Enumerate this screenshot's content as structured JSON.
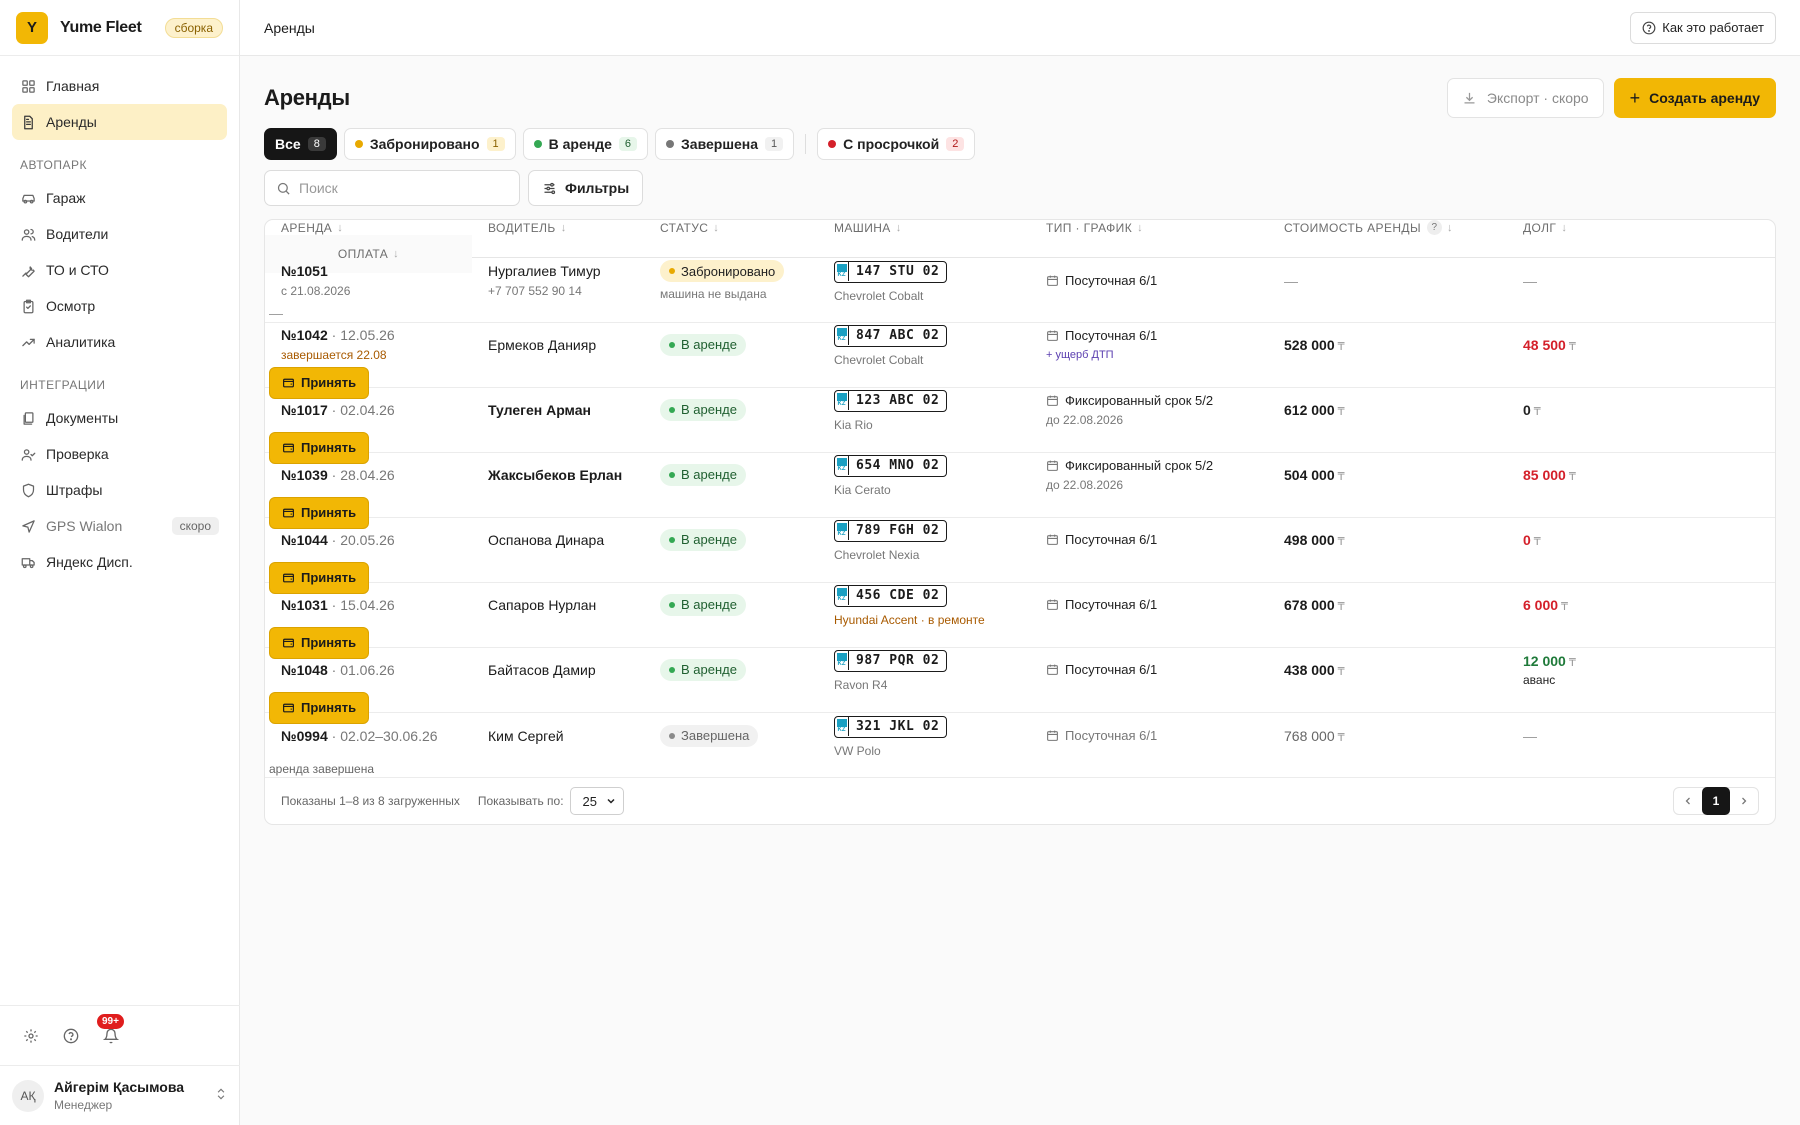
{
  "brand": {
    "logo_letter": "Y",
    "name": "Yume Fleet",
    "badge": "сборка"
  },
  "nav": {
    "items": [
      {
        "label": "Главная",
        "icon": "grid-icon"
      },
      {
        "label": "Аренды",
        "icon": "document-icon",
        "active": true
      }
    ],
    "sections": [
      {
        "title": "АВТОПАРК",
        "items": [
          {
            "label": "Гараж",
            "icon": "car-icon"
          },
          {
            "label": "Водители",
            "icon": "users-icon"
          },
          {
            "label": "ТО и СТО",
            "icon": "wrench-icon"
          },
          {
            "label": "Осмотр",
            "icon": "clipboard-icon"
          },
          {
            "label": "Аналитика",
            "icon": "trend-icon"
          }
        ]
      },
      {
        "title": "ИНТЕГРАЦИИ",
        "items": [
          {
            "label": "Документы",
            "icon": "documents-icon"
          },
          {
            "label": "Проверка",
            "icon": "user-check-icon"
          },
          {
            "label": "Штрафы",
            "icon": "shield-icon"
          },
          {
            "label": "GPS Wialon",
            "icon": "navigation-icon",
            "soon": "скоро"
          },
          {
            "label": "Яндекс Дисп.",
            "icon": "truck-icon"
          }
        ]
      }
    ]
  },
  "notifications": {
    "count": "99+"
  },
  "user": {
    "initials": "АҚ",
    "name": "Айгерім Қасымова",
    "role": "Менеджер"
  },
  "topbar": {
    "breadcrumb": "Аренды",
    "help_label": "Как это работает"
  },
  "page": {
    "title": "Аренды",
    "export_label": "Экспорт · скоро",
    "create_label": "Создать аренду"
  },
  "tabs": [
    {
      "label": "Все",
      "count": "8",
      "active": true
    },
    {
      "label": "Забронировано",
      "count": "1",
      "dot": "#e8a900",
      "count_bg": "#fdf1cc",
      "count_color": "#8a6100"
    },
    {
      "label": "В аренде",
      "count": "6",
      "dot": "#34a853",
      "count_bg": "#e7f6ea",
      "count_color": "#1f5f30"
    },
    {
      "label": "Завершена",
      "count": "1",
      "dot": "#777777",
      "count_bg": "#f1f1f1",
      "count_color": "#555555"
    },
    {
      "label": "С просрочкой",
      "count": "2",
      "dot": "#d4202a",
      "count_bg": "#fde3e3",
      "count_color": "#b01a1a",
      "separated": true
    }
  ],
  "search": {
    "placeholder": "Поиск"
  },
  "filters_label": "Фильтры",
  "table": {
    "columns": [
      "АРЕНДА",
      "ВОДИТЕЛЬ",
      "СТАТУС",
      "МАШИНА",
      "ТИП · ГРАФИК",
      "СТОИМОСТЬ АРЕНДЫ",
      "ДОЛГ",
      "ОПЛАТА"
    ],
    "rows": [
      {
        "num": "№1051",
        "date": "",
        "sub": "с 21.08.2026",
        "sub_warn": false,
        "driver": "Нургалиев Тимур",
        "phone": "+7 707 552 90 14",
        "driver_bold": false,
        "status": "Забронировано",
        "status_kind": "booked",
        "status_note": "машина не выдана",
        "plate": "147 STU 02",
        "car": "Chevrolet Cobalt",
        "car_warn": false,
        "schedule": "Посуточная 6/1",
        "schedule_note": "",
        "schedule_note_kind": "",
        "cost": "—",
        "cost_cur": "",
        "debt": "—",
        "debt_cur": "",
        "debt_kind": "dash",
        "debt_note": "",
        "pay": "dash",
        "pay_value": "—"
      },
      {
        "num": "№1042",
        "date": "· 12.05.26",
        "sub": "завершается 22.08",
        "sub_warn": true,
        "driver": "Ермеков Данияр",
        "phone": "",
        "driver_bold": false,
        "status": "В аренде",
        "status_kind": "active",
        "status_note": "",
        "plate": "847 ABC 02",
        "car": "Chevrolet Cobalt",
        "car_warn": false,
        "schedule": "Посуточная 6/1",
        "schedule_note": "+ ущерб ДТП",
        "schedule_note_kind": "purple",
        "cost": "528 000",
        "cost_cur": "₸",
        "debt": "48 500",
        "debt_cur": "₸",
        "debt_kind": "red",
        "debt_note": "",
        "pay": "button",
        "pay_value": "Принять"
      },
      {
        "num": "№1017",
        "date": "· 02.04.26",
        "sub": "",
        "sub_warn": false,
        "driver": "Тулеген Арман",
        "phone": "",
        "driver_bold": true,
        "status": "В аренде",
        "status_kind": "active",
        "status_note": "",
        "plate": "123 ABC 02",
        "car": "Kia Rio",
        "car_warn": false,
        "schedule": "Фиксированный срок 5/2",
        "schedule_note": "до 22.08.2026",
        "schedule_note_kind": "gray",
        "cost": "612 000",
        "cost_cur": "₸",
        "debt": "0",
        "debt_cur": "₸",
        "debt_kind": "dark",
        "debt_note": "",
        "pay": "button",
        "pay_value": "Принять"
      },
      {
        "num": "№1039",
        "date": "· 28.04.26",
        "sub": "",
        "sub_warn": false,
        "driver": "Жаксыбеков Ерлан",
        "phone": "",
        "driver_bold": true,
        "status": "В аренде",
        "status_kind": "active",
        "status_note": "",
        "plate": "654 MNO 02",
        "car": "Kia Cerato",
        "car_warn": false,
        "schedule": "Фиксированный срок 5/2",
        "schedule_note": "до 22.08.2026",
        "schedule_note_kind": "gray",
        "cost": "504 000",
        "cost_cur": "₸",
        "debt": "85 000",
        "debt_cur": "₸",
        "debt_kind": "red",
        "debt_note": "",
        "pay": "button",
        "pay_value": "Принять"
      },
      {
        "num": "№1044",
        "date": "· 20.05.26",
        "sub": "",
        "sub_warn": false,
        "driver": "Оспанова Динара",
        "phone": "",
        "driver_bold": false,
        "status": "В аренде",
        "status_kind": "active",
        "status_note": "",
        "plate": "789 FGH 02",
        "car": "Chevrolet Nexia",
        "car_warn": false,
        "schedule": "Посуточная 6/1",
        "schedule_note": "",
        "schedule_note_kind": "",
        "cost": "498 000",
        "cost_cur": "₸",
        "debt": "0",
        "debt_cur": "₸",
        "debt_kind": "red",
        "debt_note": "",
        "pay": "button",
        "pay_value": "Принять"
      },
      {
        "num": "№1031",
        "date": "· 15.04.26",
        "sub": "",
        "sub_warn": false,
        "driver": "Сапаров Нурлан",
        "phone": "",
        "driver_bold": false,
        "status": "В аренде",
        "status_kind": "active",
        "status_note": "",
        "plate": "456 CDE 02",
        "car": "Hyundai Accent · в ремонте",
        "car_warn": true,
        "schedule": "Посуточная 6/1",
        "schedule_note": "",
        "schedule_note_kind": "",
        "cost": "678 000",
        "cost_cur": "₸",
        "debt": "6 000",
        "debt_cur": "₸",
        "debt_kind": "red",
        "debt_note": "",
        "pay": "button",
        "pay_value": "Принять"
      },
      {
        "num": "№1048",
        "date": "· 01.06.26",
        "sub": "",
        "sub_warn": false,
        "driver": "Байтасов Дамир",
        "phone": "",
        "driver_bold": false,
        "status": "В аренде",
        "status_kind": "active",
        "status_note": "",
        "plate": "987 PQR 02",
        "car": "Ravon R4",
        "car_warn": false,
        "schedule": "Посуточная 6/1",
        "schedule_note": "",
        "schedule_note_kind": "",
        "cost": "438 000",
        "cost_cur": "₸",
        "debt": "12 000",
        "debt_cur": "₸",
        "debt_kind": "green",
        "debt_note": "аванс",
        "pay": "button",
        "pay_value": "Принять"
      },
      {
        "num": "№0994",
        "date": "· 02.02–30.06.26",
        "sub": "",
        "sub_warn": false,
        "driver": "Ким Сергей",
        "phone": "",
        "driver_bold": false,
        "status": "Завершена",
        "status_kind": "done",
        "status_note": "",
        "plate": "321 JKL 02",
        "car": "VW Polo",
        "car_warn": false,
        "schedule": "Посуточная 6/1",
        "schedule_note": "",
        "schedule_note_kind": "dim",
        "cost": "768 000",
        "cost_cur": "₸",
        "debt": "—",
        "debt_cur": "",
        "debt_kind": "dash",
        "debt_note": "",
        "pay": "text",
        "pay_value": "аренда завершена",
        "dim": true
      }
    ]
  },
  "footer": {
    "shown": "Показаны 1–8 из 8 загруженных",
    "per_page_label": "Показывать по:",
    "per_page": "25",
    "page": "1"
  },
  "colors": {
    "accent": "#f2b705",
    "danger": "#d4202a",
    "success": "#34a853"
  }
}
